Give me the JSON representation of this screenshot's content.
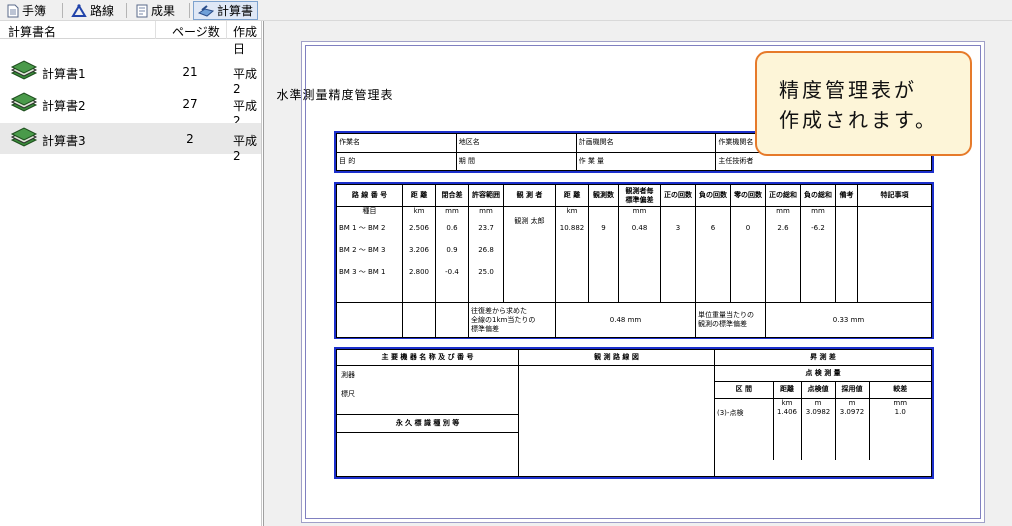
{
  "toolbar": {
    "tabs": [
      {
        "label": "手簿",
        "icon": "document-icon"
      },
      {
        "label": "路線",
        "icon": "route-icon"
      },
      {
        "label": "成果",
        "icon": "results-icon"
      },
      {
        "label": "計算書",
        "icon": "calc-sheet-icon"
      }
    ],
    "active_tab": "計算書"
  },
  "list": {
    "columns": [
      "計算書名",
      "ページ数",
      "作成日"
    ],
    "rows": [
      {
        "name": "計算書1",
        "pages": "21",
        "date": "平成2"
      },
      {
        "name": "計算書2",
        "pages": "27",
        "date": "平成2"
      },
      {
        "name": "計算書3",
        "pages": "2",
        "date": "平成2"
      }
    ]
  },
  "document": {
    "title": "水準測量精度管理表",
    "header": {
      "work_name": "作業名",
      "area_name": "地区名",
      "plan_org": "計画機関名",
      "work_org": "作業機関名",
      "purpose": "目 的",
      "period": "期 間",
      "amount": "作 業 量",
      "chief": "主任技術者"
    },
    "precision": {
      "headers": [
        "路 線 番 号",
        "距 離",
        "閉合差",
        "許容範囲",
        "観 測 者",
        "距 離",
        "観測数",
        "観測者毎\n標準偏差",
        "正の回数",
        "負の回数",
        "零の回数",
        "正の総和",
        "負の総和",
        "備考",
        "特記事項"
      ],
      "units": [
        "種目",
        "km",
        "mm",
        "mm",
        "",
        "km",
        "",
        "mm",
        "",
        "",
        "",
        "mm",
        "mm",
        "",
        ""
      ],
      "routes": [
        {
          "route": "BM 1 ～ BM 2",
          "dist": "2.506",
          "closure": "0.6",
          "allow": "23.7"
        },
        {
          "route": "BM 2 ～ BM 3",
          "dist": "3.206",
          "closure": "0.9",
          "allow": "26.8"
        },
        {
          "route": "BM 3 ～ BM 1",
          "dist": "2.800",
          "closure": "-0.4",
          "allow": "25.0"
        }
      ],
      "observer": {
        "name": "観測 太郎",
        "dist": "10.882",
        "count": "9",
        "sd": "0.48",
        "pos": "3",
        "neg": "6",
        "zero": "0",
        "pos_sum": "2.6",
        "neg_sum": "-6.2"
      },
      "footer_left_label": "往復差から求めた\n全線の1km当たりの\n標準偏差",
      "footer_left_value": "0.48 mm",
      "footer_right_label": "単位重量当たりの\n観測の標準偏差",
      "footer_right_value": "0.33 mm"
    },
    "bottom": {
      "equip_header": "主 要 機 器 名 称 及 び 番 号",
      "equip_items": [
        "測器",
        "標尺"
      ],
      "perm_header": "永 久 標 識 種 別 等",
      "diagram_header": "観 測 路 線 図",
      "diff_header": "昇 測 差",
      "check_header": "点 検 測 量",
      "check_columns": [
        "区 間",
        "距離",
        "点検値",
        "採用値",
        "較差"
      ],
      "check_units": [
        "",
        "km",
        "m",
        "m",
        "mm"
      ],
      "check_row": {
        "section": "(3)-点検",
        "dist": "1.406",
        "check": "3.0982",
        "adopted": "3.0972",
        "diff": "1.0"
      }
    }
  },
  "callout": {
    "text": "精度管理表が\n作成されます。"
  }
}
